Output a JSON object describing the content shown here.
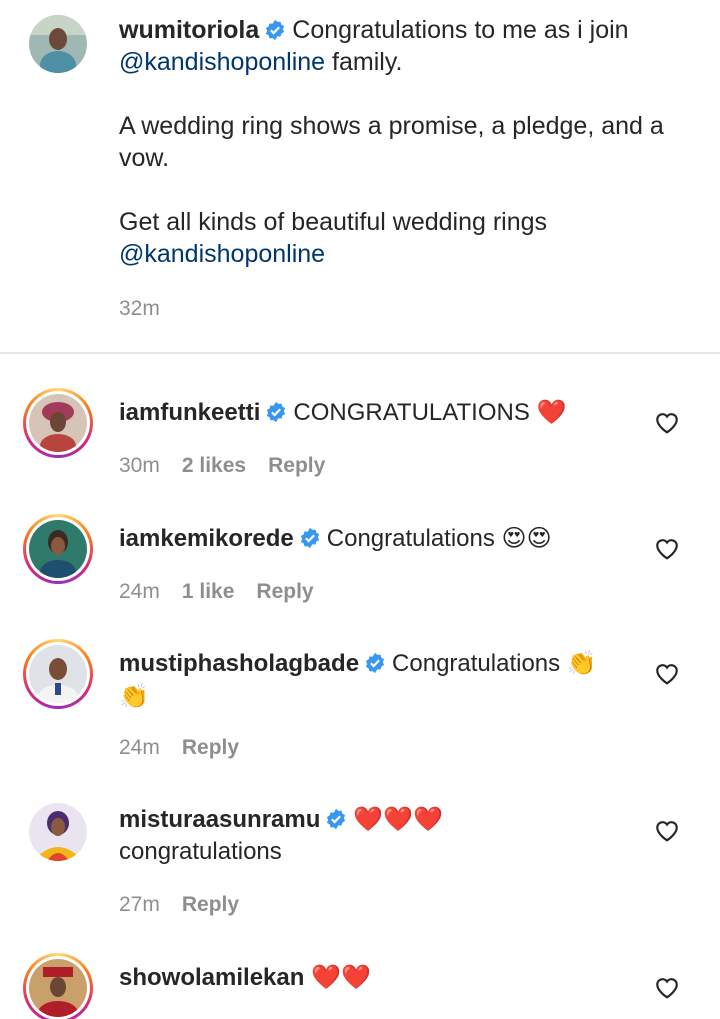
{
  "caption": {
    "username": "wumitoriola",
    "line1": "Congratulations to me as i join",
    "mention1": "@kandishoponline",
    "line1_end": " family.",
    "para2": "A wedding ring shows a promise, a pledge, and a vow.",
    "para3": "Get all kinds of beautiful wedding rings",
    "mention2": "@kandishoponline",
    "time": "32m"
  },
  "comments": [
    {
      "username": "iamfunkeetti",
      "text": "CONGRATULATIONS",
      "emoji": "❤️",
      "time": "30m",
      "likes": "2 likes",
      "reply": "Reply"
    },
    {
      "username": "iamkemikorede",
      "text": "Congratulations",
      "emoji": "😍😍",
      "time": "24m",
      "likes": "1 like",
      "reply": "Reply"
    },
    {
      "username": "mustiphasholagbade",
      "text": "Congratulations",
      "emoji": "👏",
      "emoji2": "👏",
      "time": "24m",
      "reply": "Reply"
    },
    {
      "username": "misturaasunramu",
      "emoji": "❤️❤️❤️",
      "text": "congratulations",
      "time": "27m",
      "reply": "Reply"
    },
    {
      "username": "showolamilekan",
      "emoji": "❤️❤️"
    }
  ],
  "colors": {
    "text": "#262626",
    "meta": "#8e8e8e",
    "mention": "#00376b",
    "verified": "#3897f0",
    "heart": "#e0141e"
  }
}
